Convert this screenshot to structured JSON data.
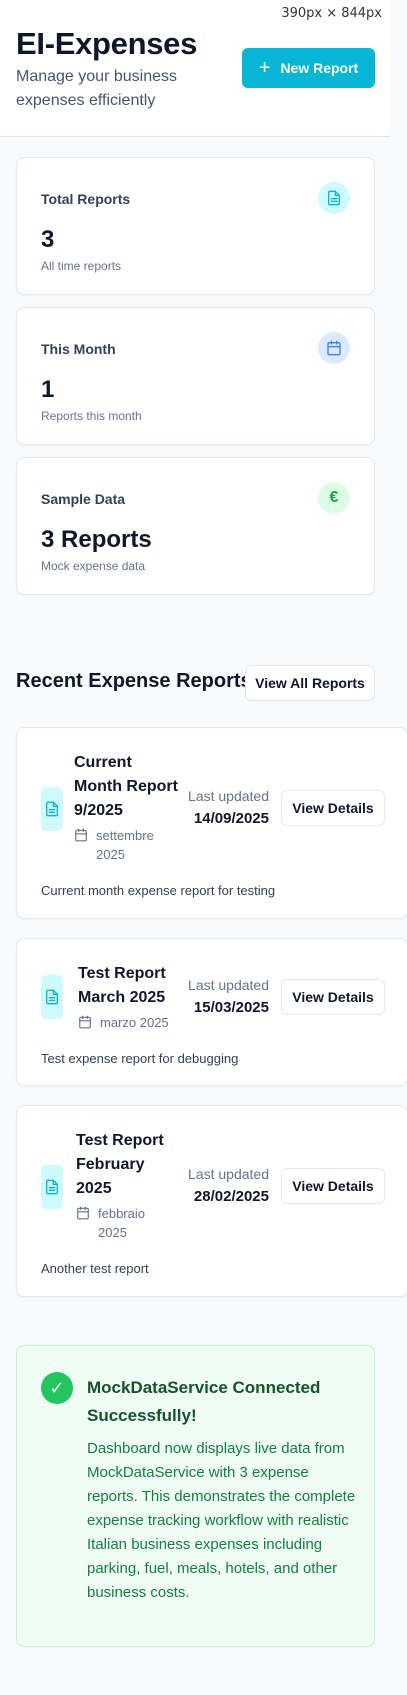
{
  "viewport_label": "390px × 844px",
  "header": {
    "title": "EI-Expenses",
    "subtitle": "Manage your business expenses efficiently",
    "new_report_label": "New Report"
  },
  "stats": [
    {
      "label": "Total Reports",
      "value": "3",
      "desc": "All time reports",
      "icon": "file-text-icon",
      "icon_bg": "#cffafe",
      "icon_color": "#06b6d4"
    },
    {
      "label": "This Month",
      "value": "1",
      "desc": "Reports this month",
      "icon": "calendar-icon",
      "icon_bg": "#dbeafe",
      "icon_color": "#3b82f6"
    },
    {
      "label": "Sample Data",
      "value": "3 Reports",
      "desc": "Mock expense data",
      "icon": "euro-icon",
      "icon_bg": "#dcfce7",
      "icon_color": "#16a34a"
    }
  ],
  "recent": {
    "title": "Recent Expense Reports",
    "view_all_label": "View All Reports"
  },
  "reports": [
    {
      "title": "Current Month Report 9/2025",
      "month": "settembre 2025",
      "updated_label": "Last updated",
      "updated_date": "14/09/2025",
      "details_label": "View Details",
      "description": "Current month expense report for testing"
    },
    {
      "title": "Test Report March 2025",
      "month": "marzo 2025",
      "updated_label": "Last updated",
      "updated_date": "15/03/2025",
      "details_label": "View Details",
      "description": "Test expense report for debugging"
    },
    {
      "title": "Test Report February 2025",
      "month": "febbraio 2025",
      "updated_label": "Last updated",
      "updated_date": "28/02/2025",
      "details_label": "View Details",
      "description": "Another test report"
    }
  ],
  "success": {
    "check": "✓",
    "title": "MockDataService Connected Successfully!",
    "text": "Dashboard now displays live data from MockDataService with 3 expense reports. This demonstrates the complete expense tracking workflow with realistic Italian business expenses including parking, fuel, meals, hotels, and other business costs."
  },
  "colors": {
    "accent": "#06b6d4",
    "success": "#22c55e"
  }
}
